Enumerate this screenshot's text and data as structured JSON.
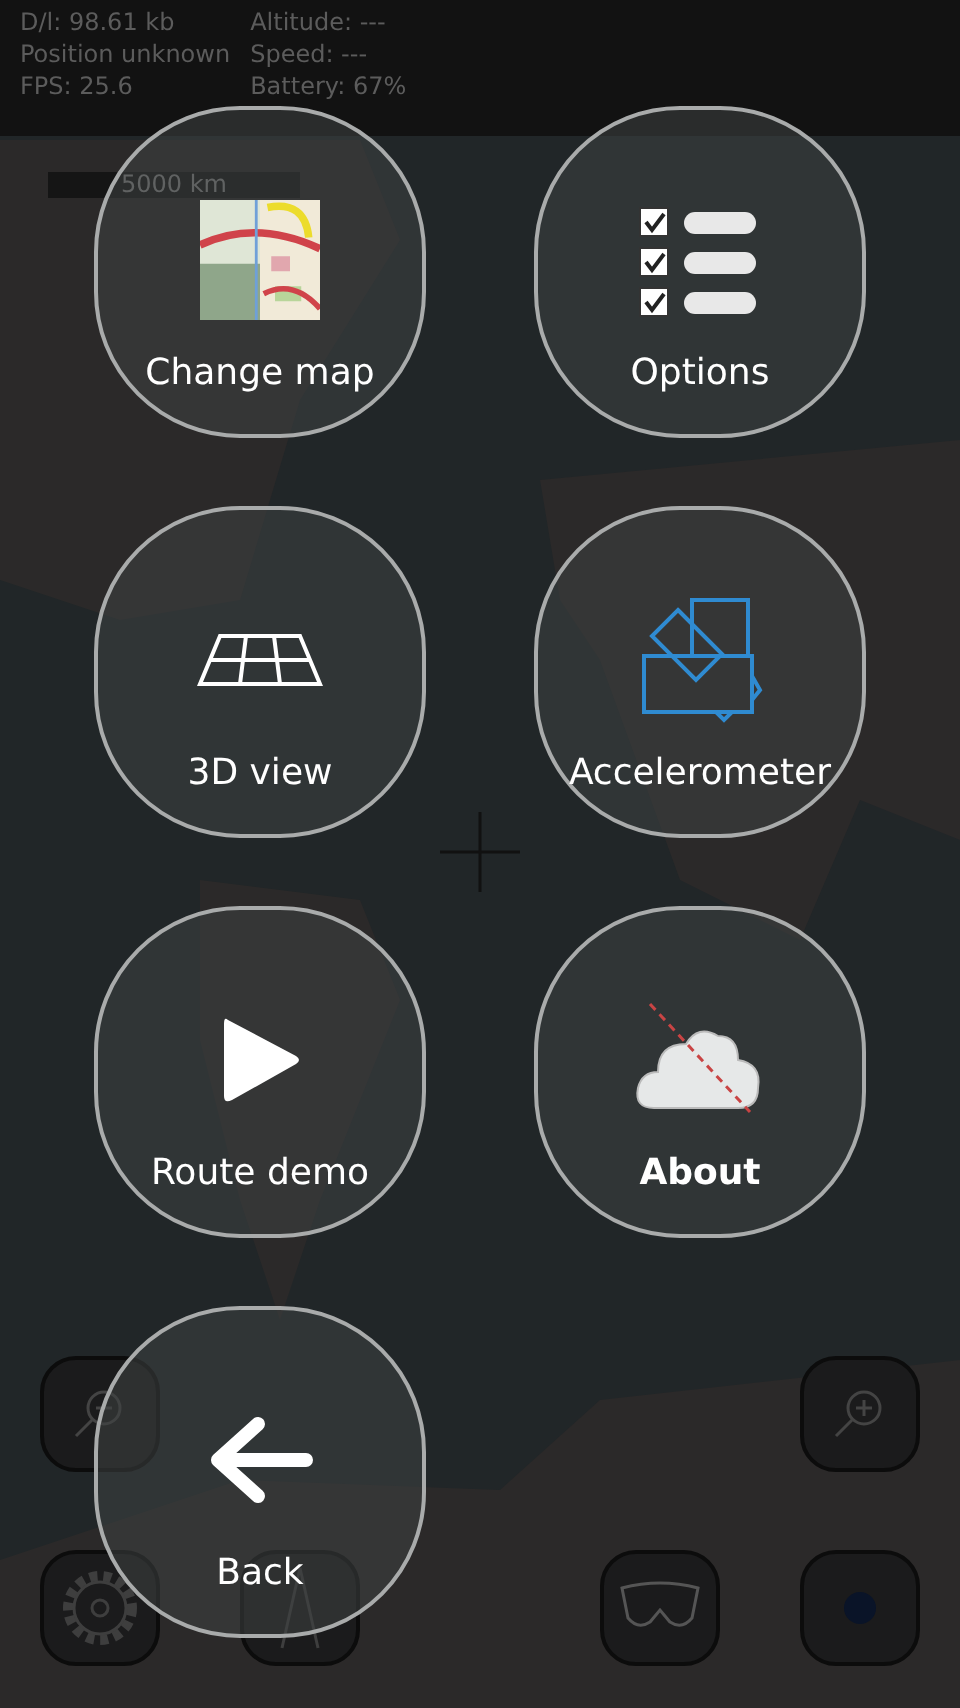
{
  "status": {
    "left": [
      "D/l: 98.61 kb",
      "Position unknown",
      "FPS: 25.6"
    ],
    "right": [
      "Altitude: ---",
      "Speed: ---",
      "Battery: 67%"
    ]
  },
  "map": {
    "scale": "5000 km"
  },
  "map_controls": [
    {
      "kind": "zoom-out"
    },
    {
      "kind": "zoom-in"
    },
    {
      "kind": "settings"
    },
    {
      "kind": "compass"
    },
    {
      "kind": "goggles"
    },
    {
      "kind": "record",
      "color": "#0a1428"
    }
  ],
  "menu": [
    {
      "kind": "map",
      "label": "Change map",
      "selected": false
    },
    {
      "kind": "options",
      "label": "Options",
      "selected": false
    },
    {
      "kind": "perspective",
      "label": "3D view",
      "selected": false
    },
    {
      "kind": "accelerometer",
      "label": "Accelerometer",
      "selected": false
    },
    {
      "kind": "play",
      "label": "Route demo",
      "selected": false
    },
    {
      "kind": "about",
      "label": "About",
      "selected": true
    },
    {
      "kind": "back",
      "label": "Back",
      "selected": false
    }
  ]
}
